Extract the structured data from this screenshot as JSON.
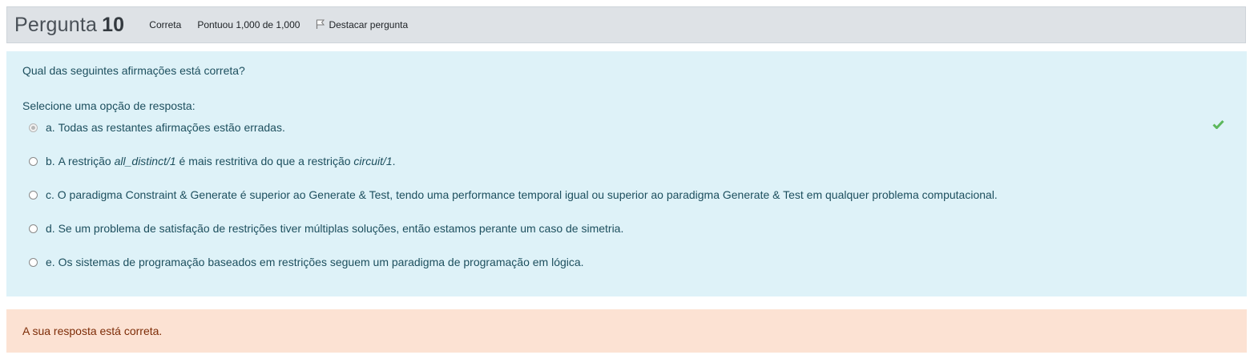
{
  "info": {
    "title_word": "Pergunta",
    "number": "10",
    "state": "Correta",
    "grade": "Pontuou 1,000 de 1,000",
    "flag_label": "Destacar pergunta",
    "flag_icon": "flag-icon"
  },
  "question": {
    "text": "Qual das seguintes afirmações está correta?",
    "prompt": "Selecione uma opção de resposta:",
    "options": [
      {
        "letter": "a.",
        "text": "Todas as restantes afirmações estão erradas.",
        "selected": true
      },
      {
        "letter": "b.",
        "pre": "A restrição ",
        "em1": "all_distinct/1",
        "mid": " é mais restritiva do que a restrição ",
        "em2": "circuit/1",
        "post": ".",
        "selected": false
      },
      {
        "letter": "c.",
        "text": "O paradigma Constraint & Generate é superior ao Generate & Test, tendo uma performance temporal igual ou superior ao paradigma Generate & Test em qualquer problema computacional.",
        "selected": false
      },
      {
        "letter": "d.",
        "text": "Se um problema de satisfação de restrições tiver múltiplas soluções, então estamos perante um caso de simetria.",
        "selected": false
      },
      {
        "letter": "e.",
        "text": "Os sistemas de programação baseados em restrições seguem um paradigma de programação em lógica.",
        "selected": false
      }
    ],
    "correct_icon": "checkmark-icon",
    "correct_color": "#5cb85c"
  },
  "feedback": {
    "text": "A sua resposta está correta."
  },
  "colors": {
    "info_bg": "#dee2e6",
    "formulation_bg": "#def2f8",
    "formulation_text": "#1d4f5e",
    "feedback_bg": "#fce2d3",
    "feedback_text": "#7d2c07"
  }
}
